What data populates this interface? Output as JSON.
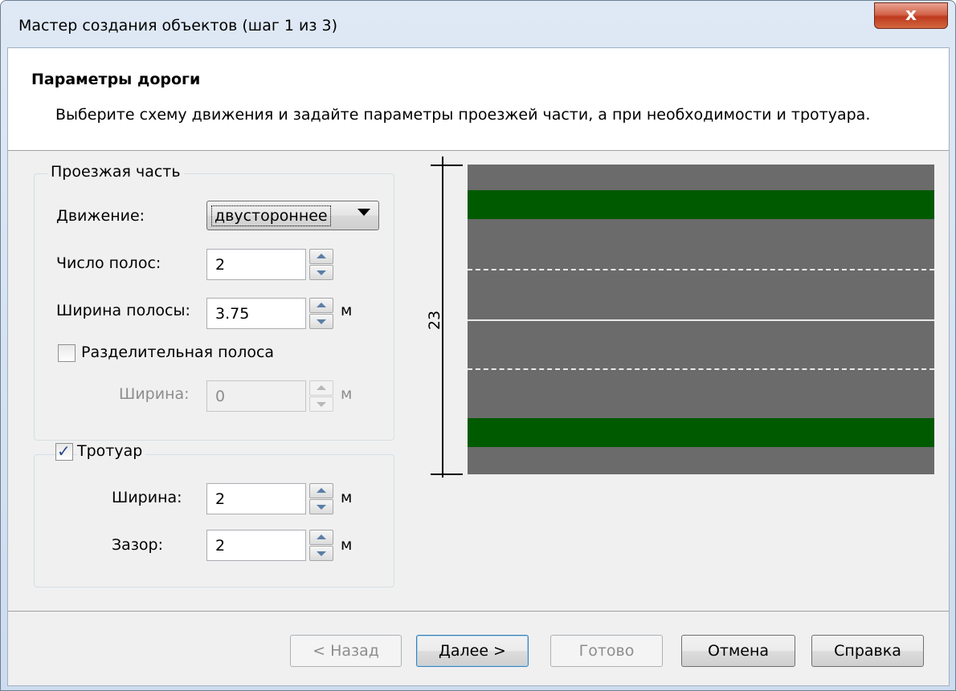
{
  "window": {
    "title": "Мастер создания объектов (шаг 1 из 3)",
    "close_glyph": "x"
  },
  "header": {
    "title": "Параметры дороги",
    "description": "Выберите схему движения и задайте параметры проезжей части, а при необходимости и тротуара."
  },
  "roadway": {
    "legend": "Проезжая часть",
    "traffic_label": "Движение:",
    "traffic_value": "двустороннее",
    "lanes_label": "Число полос:",
    "lanes_value": "2",
    "lane_width_label": "Ширина полосы:",
    "lane_width_value": "3.75",
    "unit": "м",
    "divider_label": "Разделительная полоса",
    "divider_checked": false,
    "divider_width_label": "Ширина:",
    "divider_width_value": "0"
  },
  "sidewalk": {
    "legend": "Тротуар",
    "checked": true,
    "width_label": "Ширина:",
    "width_value": "2",
    "gap_label": "Зазор:",
    "gap_value": "2",
    "unit": "м"
  },
  "preview": {
    "dimension": "23",
    "colors": {
      "asphalt": "#6b6b6b",
      "sidewalk": "#005a00"
    }
  },
  "buttons": {
    "back": "< Назад",
    "next": "Далее >",
    "finish": "Готово",
    "cancel": "Отмена",
    "help": "Справка"
  }
}
